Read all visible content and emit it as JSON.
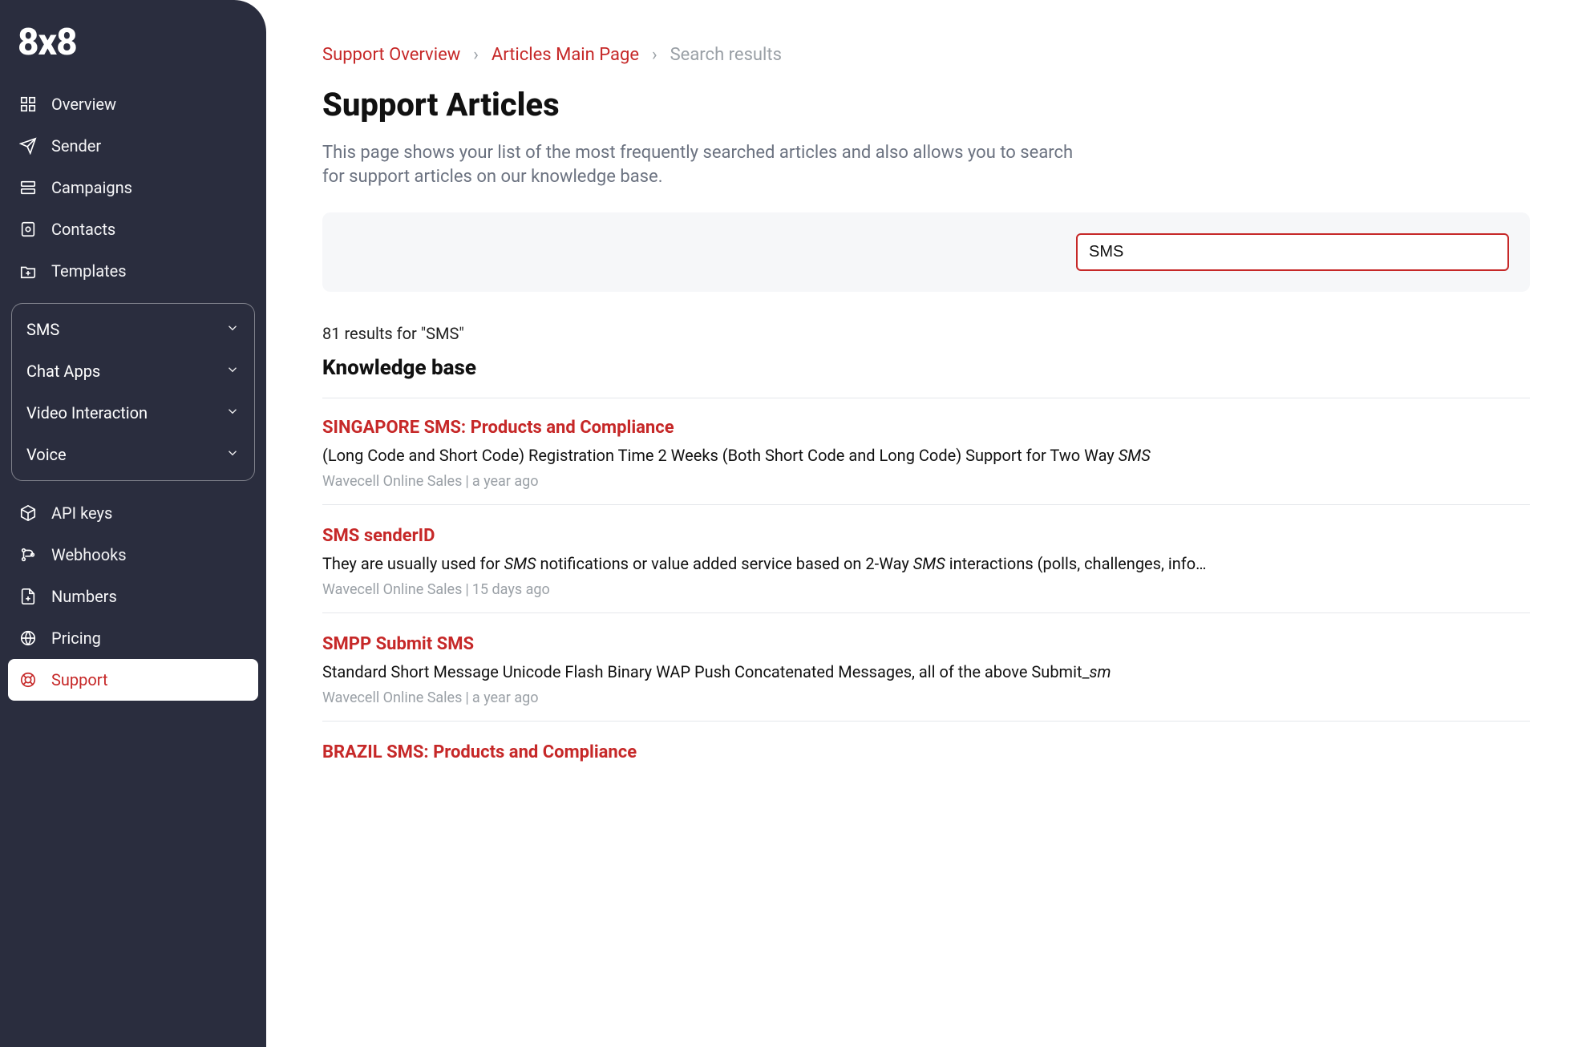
{
  "brand": "8x8",
  "sidebar": {
    "items": [
      {
        "id": "overview",
        "label": "Overview"
      },
      {
        "id": "sender",
        "label": "Sender"
      },
      {
        "id": "campaigns",
        "label": "Campaigns"
      },
      {
        "id": "contacts",
        "label": "Contacts"
      },
      {
        "id": "templates",
        "label": "Templates"
      }
    ],
    "group_items": [
      {
        "id": "sms",
        "label": "SMS"
      },
      {
        "id": "chatapps",
        "label": "Chat Apps"
      },
      {
        "id": "video",
        "label": "Video Interaction"
      },
      {
        "id": "voice",
        "label": "Voice"
      }
    ],
    "items2": [
      {
        "id": "apikeys",
        "label": "API keys"
      },
      {
        "id": "webhooks",
        "label": "Webhooks"
      },
      {
        "id": "numbers",
        "label": "Numbers"
      },
      {
        "id": "pricing",
        "label": "Pricing"
      },
      {
        "id": "support",
        "label": "Support"
      }
    ]
  },
  "breadcrumbs": {
    "a": "Support Overview",
    "b": "Articles Main Page",
    "c": "Search results"
  },
  "page": {
    "title": "Support Articles",
    "description": "This page shows your list of the most frequently searched articles and also allows you to search for support articles on our knowledge base."
  },
  "search": {
    "value": "SMS",
    "placeholder": "",
    "results_count_text": "81 results for \"SMS\""
  },
  "kb_heading": "Knowledge base",
  "articles": [
    {
      "title": "SINGAPORE SMS: Products and Compliance",
      "snippet_pre": "(Long Code and Short Code) Registration Time 2 Weeks (Both Short Code and Long Code) Support for Two Way ",
      "snippet_em": "SMS",
      "snippet_post": "",
      "source": "Wavecell Online Sales",
      "age": "a year ago"
    },
    {
      "title": "SMS senderID",
      "snippet_pre": "They are usually used for ",
      "snippet_em": "SMS",
      "snippet_mid": " notifications or value added service based on 2-Way ",
      "snippet_em2": "SMS",
      "snippet_post": " interactions (polls, challenges, info…",
      "source": "Wavecell Online Sales",
      "age": "15 days ago"
    },
    {
      "title": "SMPP Submit SMS",
      "snippet_pre": "Standard Short Message Unicode Flash Binary WAP Push Concatenated Messages, all of the above Submit_",
      "snippet_em": "sm",
      "snippet_post": "",
      "source": "Wavecell Online Sales",
      "age": "a year ago"
    },
    {
      "title": "BRAZIL SMS: Products and Compliance",
      "snippet_pre": "",
      "snippet_em": "",
      "snippet_post": "",
      "source": "",
      "age": ""
    }
  ]
}
